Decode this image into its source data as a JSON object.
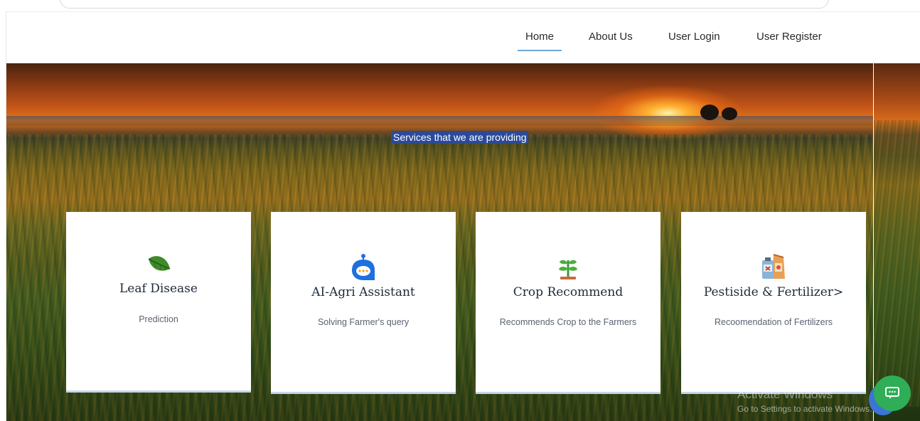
{
  "nav": {
    "items": [
      {
        "label": "Home",
        "active": true
      },
      {
        "label": "About Us",
        "active": false
      },
      {
        "label": "User Login",
        "active": false
      },
      {
        "label": "User Register",
        "active": false
      }
    ],
    "active_underline_color": "#6fa8d6"
  },
  "hero": {
    "heading": "Services that we are providing",
    "heading_bg_color": "#2a4a9a"
  },
  "services": [
    {
      "title": "Leaf Disease",
      "description": "Prediction",
      "icon": "leaf-icon"
    },
    {
      "title": "AI-Agri Assistant",
      "description": "Solving Farmer's query",
      "icon": "chatbot-icon"
    },
    {
      "title": "Crop Recommend",
      "description": "Recommends Crop to the Farmers",
      "icon": "sprout-icon"
    },
    {
      "title": "Pestiside & Fertilizer>",
      "description": "Recoomendation of Fertilizers",
      "icon": "fertilizer-bag-icon"
    }
  ],
  "watermark": {
    "title": "Activate Windows",
    "subtitle": "Go to Settings to activate Windows."
  },
  "chat_widget": {
    "icon": "chat-bubble-icon",
    "color": "#2fae57"
  }
}
